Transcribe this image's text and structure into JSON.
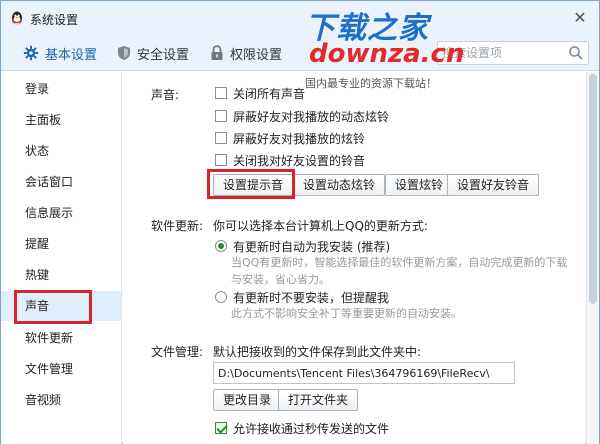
{
  "window": {
    "title": "系统设置",
    "close_glyph": "✕"
  },
  "toolbar": {
    "tabs": [
      {
        "label": "基本设置",
        "icon": "gear-icon",
        "active": true
      },
      {
        "label": "安全设置",
        "icon": "shield-icon",
        "active": false
      },
      {
        "label": "权限设置",
        "icon": "lock-icon",
        "active": false
      }
    ],
    "search_placeholder": "搜索设置项"
  },
  "sidebar": {
    "items": [
      {
        "label": "登录"
      },
      {
        "label": "主面板"
      },
      {
        "label": "状态"
      },
      {
        "label": "会话窗口"
      },
      {
        "label": "信息展示"
      },
      {
        "label": "提醒"
      },
      {
        "label": "热键"
      },
      {
        "label": "声音",
        "active": true
      },
      {
        "label": "软件更新"
      },
      {
        "label": "文件管理"
      },
      {
        "label": "音视频"
      }
    ]
  },
  "sound": {
    "section_label": "声音:",
    "checkboxes": [
      {
        "label": "关闭所有声音",
        "checked": false
      },
      {
        "label": "屏蔽好友对我播放的动态炫铃",
        "checked": false
      },
      {
        "label": "屏蔽好友对我播放的炫铃",
        "checked": false
      },
      {
        "label": "关闭我对好友设置的铃音",
        "checked": false
      }
    ],
    "buttons": [
      "设置提示音",
      "设置动态炫铃",
      "设置炫铃",
      "设置好友铃音"
    ]
  },
  "update": {
    "section_label": "软件更新:",
    "intro": "你可以选择本台计算机上QQ的更新方式:",
    "options": [
      {
        "label": "有更新时自动为我安装 (推荐)",
        "checked": true,
        "desc_line1": "当QQ有更新时，智能选择最佳的软件更新方案，自动完成更新的下载",
        "desc_line2": "与安装，省心省力。"
      },
      {
        "label": "有更新时不要安装，但提醒我",
        "checked": false,
        "desc_line1": "此方式不影响安全补丁等重要更新的自动安装。"
      }
    ]
  },
  "files": {
    "section_label": "文件管理:",
    "intro": "默认把接收到的文件保存到此文件夹中:",
    "path": "D:\\Documents\\Tencent Files\\364796169\\FileRecv\\",
    "buttons": [
      "更改目录",
      "打开文件夹"
    ],
    "allow_label": "允许接收通过秒传发送的文件",
    "allow_checked": true
  },
  "watermark": {
    "title": "下载之家",
    "domain": "downza.cn",
    "slogan": "国内最专业的资源下载站！"
  },
  "colors": {
    "accent": "#1e66ad",
    "highlight_box": "#d8232a",
    "title_bar": "#eaf3fb"
  }
}
